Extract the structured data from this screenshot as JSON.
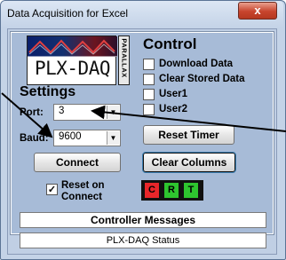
{
  "window": {
    "title": "Data Acquisition for Excel",
    "close_label": "x"
  },
  "logo": {
    "text": "PLX-DAQ",
    "vertical_text": "PARALLAX"
  },
  "control": {
    "heading": "Control",
    "checkboxes": [
      {
        "label": "Download Data",
        "checked": false
      },
      {
        "label": "Clear Stored Data",
        "checked": false
      },
      {
        "label": "User1",
        "checked": false
      },
      {
        "label": "User2",
        "checked": false
      }
    ],
    "reset_timer_label": "Reset Timer",
    "clear_columns_label": "Clear Columns"
  },
  "settings": {
    "heading": "Settings",
    "port_label": "Port:",
    "port_value": "3",
    "baud_label": "Baud:",
    "baud_value": "9600",
    "connect_label": "Connect",
    "reset_on_connect_line1": "Reset on",
    "reset_on_connect_line2": "Connect",
    "reset_on_connect_checked": true
  },
  "indicators": [
    {
      "label": "C",
      "color": "#e8262a"
    },
    {
      "label": "R",
      "color": "#2ec52f"
    },
    {
      "label": "T",
      "color": "#2ec52f"
    }
  ],
  "messages": {
    "header": "Controller Messages",
    "status": "PLX-DAQ Status"
  },
  "colors": {
    "window_bg": "#c4d3e7",
    "panel_bg": "#a7bbd7",
    "close_red": "#c7442d"
  }
}
